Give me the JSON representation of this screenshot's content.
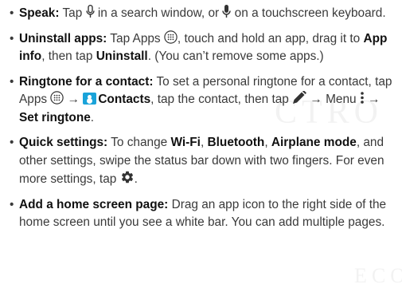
{
  "watermark": [
    "CTRO",
    "ECO"
  ],
  "bullets": [
    {
      "title": "Speak:",
      "p1": " Tap ",
      "p2": " in a search window, or ",
      "p3": " on a touchscreen keyboard."
    },
    {
      "title": "Uninstall apps:",
      "p1": " Tap Apps ",
      "p2": ", touch and hold an app, drag it to ",
      "b1": "App info",
      "p3": ", then tap ",
      "b2": "Uninstall",
      "p4": ". (You can’t remove some apps.)"
    },
    {
      "title": "Ringtone for a contact:",
      "p1": " To set a personal ringtone for a contact, tap Apps ",
      "arrow1": " → ",
      "b1": "Contacts",
      "p2": ", tap the contact, then tap ",
      "arrow2": " → Menu ",
      "arrow3": " → ",
      "b2": "Set ringtone",
      "p3": "."
    },
    {
      "title": "Quick settings:",
      "p1": " To change ",
      "b1": "Wi-Fi",
      "p2": ", ",
      "b2": "Bluetooth",
      "p3": ", ",
      "b3": "Airplane mode",
      "p4": ", and other settings, swipe the status bar down with two fingers. For even more settings, tap ",
      "p5": "."
    },
    {
      "title": "Add a home screen page:",
      "p1": " Drag an app icon to the right side of the home screen until you see a white bar. You can add multiple pages."
    }
  ]
}
